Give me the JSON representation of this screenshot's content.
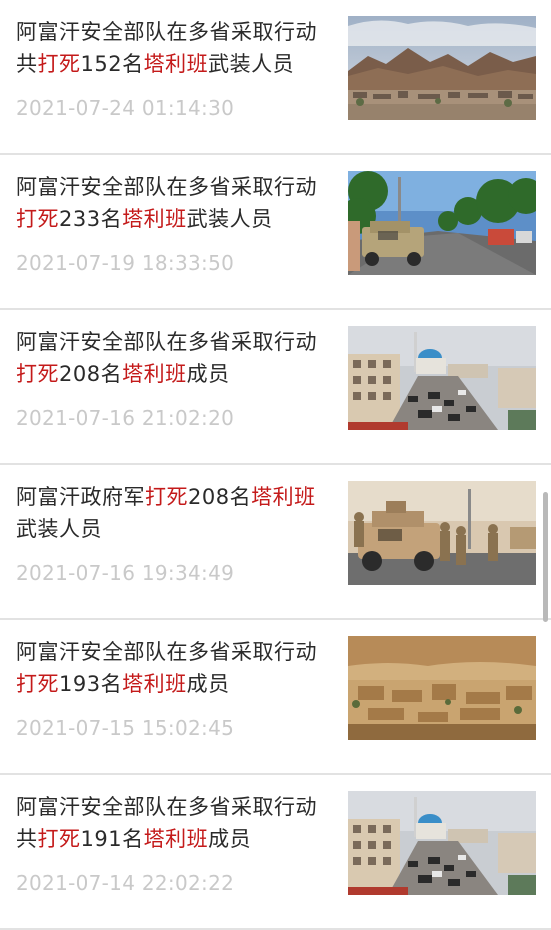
{
  "news_items": [
    {
      "title_parts": [
        {
          "t": "阿富汗安全部队在多省采取行动共",
          "hl": false
        },
        {
          "t": "打死",
          "hl": true
        },
        {
          "t": "152名",
          "hl": false
        },
        {
          "t": "塔利班",
          "hl": true
        },
        {
          "t": "武装人员",
          "hl": false
        }
      ],
      "time": "2021-07-24 01:14:30",
      "image": "mountain-town-photo"
    },
    {
      "title_parts": [
        {
          "t": "阿富汗安全部队在多省采取行动",
          "hl": false
        },
        {
          "t": "打死",
          "hl": true
        },
        {
          "t": "233名",
          "hl": false
        },
        {
          "t": "塔利班",
          "hl": true
        },
        {
          "t": "武装人员",
          "hl": false
        }
      ],
      "time": "2021-07-19 18:33:50",
      "image": "military-vehicle-road-photo"
    },
    {
      "title_parts": [
        {
          "t": "阿富汗安全部队在多省采取行动",
          "hl": false
        },
        {
          "t": "打死",
          "hl": true
        },
        {
          "t": "208名",
          "hl": false
        },
        {
          "t": "塔利班",
          "hl": true
        },
        {
          "t": "成员",
          "hl": false
        }
      ],
      "time": "2021-07-16 21:02:20",
      "image": "city-street-mosque-photo"
    },
    {
      "title_parts": [
        {
          "t": "阿富汗政府军",
          "hl": false
        },
        {
          "t": "打死",
          "hl": true
        },
        {
          "t": "208名",
          "hl": false
        },
        {
          "t": "塔利班",
          "hl": true
        },
        {
          "t": "武装人员",
          "hl": false
        }
      ],
      "time": "2021-07-16 19:34:49",
      "image": "soldiers-humvee-photo"
    },
    {
      "title_parts": [
        {
          "t": "阿富汗安全部队在多省采取行动",
          "hl": false
        },
        {
          "t": "打死",
          "hl": true
        },
        {
          "t": "193名",
          "hl": false
        },
        {
          "t": "塔利班",
          "hl": true
        },
        {
          "t": "成员",
          "hl": false
        }
      ],
      "time": "2021-07-15 15:02:45",
      "image": "desert-village-photo"
    },
    {
      "title_parts": [
        {
          "t": "阿富汗安全部队在多省采取行动共",
          "hl": false
        },
        {
          "t": "打死",
          "hl": true
        },
        {
          "t": "191名",
          "hl": false
        },
        {
          "t": "塔利班",
          "hl": true
        },
        {
          "t": "成员",
          "hl": false
        }
      ],
      "time": "2021-07-14 22:02:22",
      "image": "city-street-mosque-photo"
    }
  ],
  "colors": {
    "highlight": "#c41a1a",
    "title": "#2a2a2a",
    "time": "#c9c9c9",
    "divider": "#e2e2e2"
  }
}
